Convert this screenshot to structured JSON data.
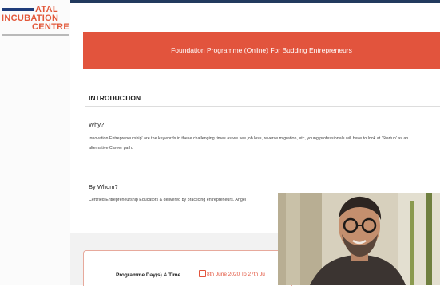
{
  "logo": {
    "line1": "ATAL",
    "line2": "INCUBATION",
    "line3": "CENTRE"
  },
  "banner": {
    "title": "Foundation Programme (Online) For Budding Entrepreneurs"
  },
  "intro": {
    "heading": "INTRODUCTION",
    "why_label": "Why?",
    "why_text": "Innovation Entrepreneurship' are the keywords in these challenging times as we see job loss, reverse migration, etc, young professionals will have to look at 'Startup' as an alternative Career path.",
    "whom_label": "By Whom?",
    "whom_text": "Certified Entrepreneurship Educators & delivered by practicing entrepreneurs. Angel I"
  },
  "schedule": {
    "label": "Programme Day(s) & Time",
    "date": "8th June 2020 To 27th Ju"
  },
  "colors": {
    "accent": "#e2543d",
    "topbar": "#223a5e"
  }
}
